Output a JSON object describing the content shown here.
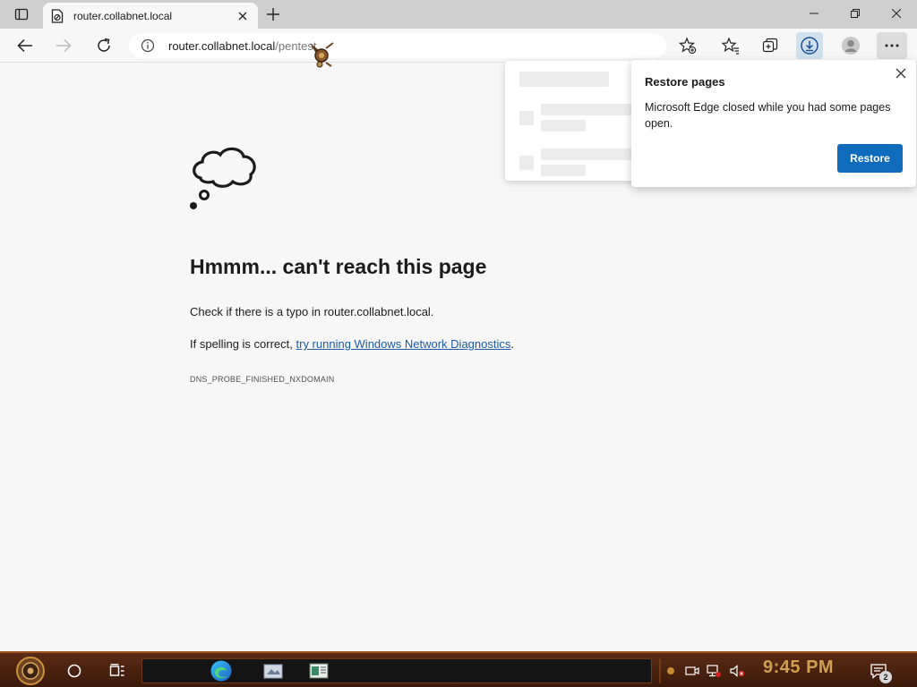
{
  "browser": {
    "tab": {
      "title": "router.collabnet.local"
    },
    "address_bar": {
      "host": "router.collabnet.local",
      "path": "/pentest"
    }
  },
  "error_page": {
    "title": "Hmmm... can't reach this page",
    "check_text": "Check if there is a typo in router.collabnet.local.",
    "spelling_prefix": "If spelling is correct, ",
    "diagnostics_link": "try running Windows Network Diagnostics",
    "spelling_suffix": ".",
    "error_code": "DNS_PROBE_FINISHED_NXDOMAIN"
  },
  "restore_popup": {
    "title": "Restore pages",
    "message": "Microsoft Edge closed while you had some pages open.",
    "button": "Restore"
  },
  "taskbar": {
    "clock": "9:45 PM",
    "notification_count": "2"
  },
  "colors": {
    "accent": "#0f6cbd",
    "link": "#1a5aa8",
    "taskbar": "#3a1a0b",
    "clock": "#d0a050"
  }
}
